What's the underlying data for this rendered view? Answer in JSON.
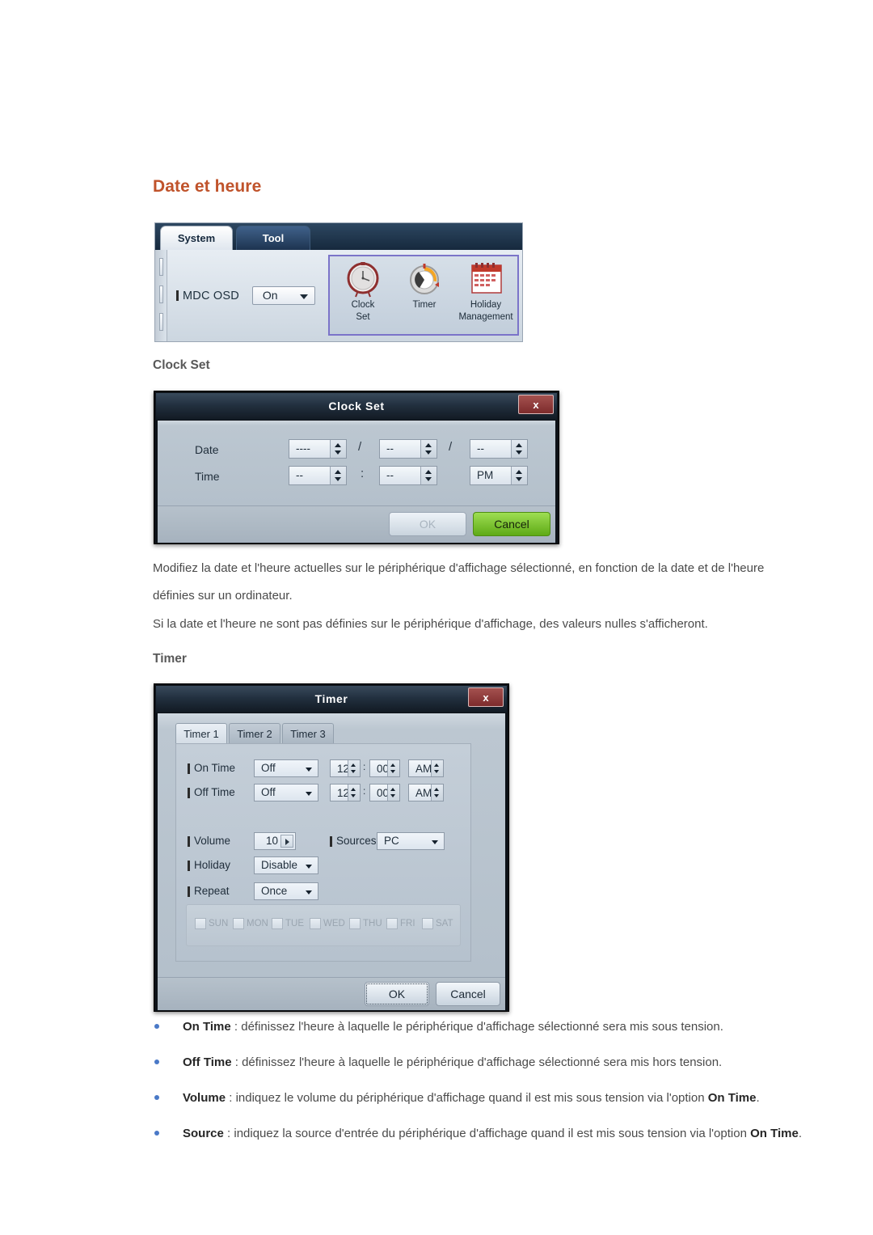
{
  "page": {
    "title": "Date et heure",
    "sections": [
      {
        "heading": "Clock Set"
      },
      {
        "heading": "Timer"
      }
    ],
    "paragraphs": [
      "Modifiez la date et l'heure actuelles sur le périphérique d'affichage sélectionné, en fonction de la date et de l'heure définies sur un ordinateur.",
      "Si la date et l'heure ne sont pas définies sur le périphérique d'affichage, des valeurs nulles s'afficheront."
    ],
    "accent_color": "#c0532b",
    "bullet_color": "#4a79c7"
  },
  "mdc_panel": {
    "tabs": [
      {
        "label": "System",
        "selected": true
      },
      {
        "label": "Tool",
        "selected": false
      }
    ],
    "osd": {
      "label": "MDC OSD",
      "value": "On"
    },
    "icons": [
      {
        "name": "clock-set-icon",
        "caption_line1": "Clock",
        "caption_line2": "Set"
      },
      {
        "name": "timer-icon",
        "caption_line1": "Timer",
        "caption_line2": ""
      },
      {
        "name": "holiday-management-icon",
        "caption_line1": "Holiday",
        "caption_line2": "Management"
      }
    ],
    "highlight_color": "#7b74c9"
  },
  "clock_set_dialog": {
    "title": "Clock Set",
    "close_label": "x",
    "date_label": "Date",
    "time_label": "Time",
    "date_year": "----",
    "date_month": "--",
    "date_day": "--",
    "date_sep1": "/",
    "date_sep2": "/",
    "time_hour": "--",
    "time_minute": "--",
    "time_meridiem": "PM",
    "time_sep": ":",
    "ok_label": "OK",
    "ok_disabled": true,
    "cancel_label": "Cancel",
    "cancel_color": "#6fb81f"
  },
  "timer_dialog": {
    "title": "Timer",
    "close_label": "x",
    "tabs": [
      {
        "label": "Timer 1",
        "selected": true
      },
      {
        "label": "Timer 2",
        "selected": false
      },
      {
        "label": "Timer 3",
        "selected": false
      }
    ],
    "rows": {
      "on_time": {
        "label": "On Time",
        "mode": "Off",
        "hour": "12",
        "minute": "00",
        "meridiem": "AM",
        "sep": ":"
      },
      "off_time": {
        "label": "Off Time",
        "mode": "Off",
        "hour": "12",
        "minute": "00",
        "meridiem": "AM",
        "sep": ":"
      },
      "volume": {
        "label": "Volume",
        "value": "10"
      },
      "sources": {
        "label": "Sources",
        "value": "PC"
      },
      "holiday": {
        "label": "Holiday",
        "value": "Disable"
      },
      "repeat": {
        "label": "Repeat",
        "value": "Once"
      }
    },
    "days": [
      {
        "label": "SUN",
        "checked": false
      },
      {
        "label": "MON",
        "checked": false
      },
      {
        "label": "TUE",
        "checked": false
      },
      {
        "label": "WED",
        "checked": false
      },
      {
        "label": "THU",
        "checked": false
      },
      {
        "label": "FRI",
        "checked": false
      },
      {
        "label": "SAT",
        "checked": false
      }
    ],
    "ok_label": "OK",
    "cancel_label": "Cancel"
  },
  "bullets": [
    {
      "term": "On Time",
      "text": " : définissez l'heure à laquelle le périphérique d'affichage sélectionné sera mis sous tension."
    },
    {
      "term": "Off Time",
      "text": " : définissez l'heure à laquelle le périphérique d'affichage sélectionné sera mis hors tension."
    },
    {
      "term": "Volume",
      "text": " : indiquez le volume du périphérique d'affichage quand il est mis sous tension via l'option ",
      "term2": "On Time",
      "text2": "."
    },
    {
      "term": "Source",
      "text": " : indiquez la source d'entrée du périphérique d'affichage quand il est mis sous tension via l'option ",
      "term2": "On Time",
      "text2": "."
    }
  ]
}
